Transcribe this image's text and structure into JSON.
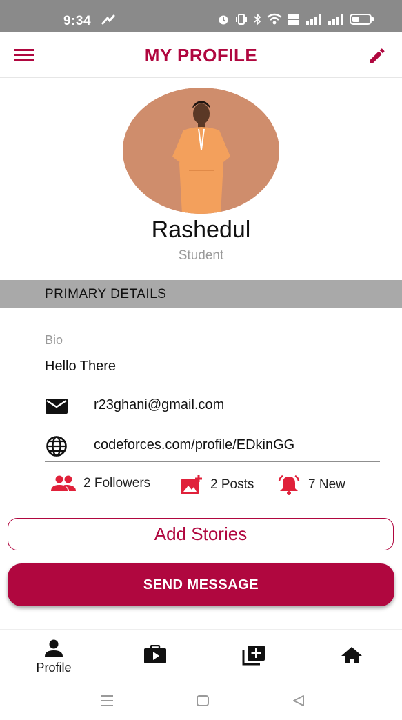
{
  "status_bar": {
    "time": "9:34"
  },
  "app_bar": {
    "title": "MY PROFILE"
  },
  "profile": {
    "name": "Rashedul",
    "role": "Student"
  },
  "section": {
    "primary_details": "PRIMARY DETAILS"
  },
  "details": {
    "bio_label": "Bio",
    "bio_value": "Hello There",
    "email": "r23ghani@gmail.com",
    "website": "codeforces.com/profile/EDkinGG"
  },
  "stats": {
    "followers": "2 Followers",
    "posts": "2 Posts",
    "notifications": "7 New"
  },
  "buttons": {
    "add_stories": "Add Stories",
    "send_message": "SEND MESSAGE"
  },
  "bottom_nav": {
    "profile_label": "Profile"
  },
  "colors": {
    "accent": "#b0073f",
    "stat_icon": "#e0213a",
    "status_bar": "#8a8a8a",
    "section_header": "#a9a9a9"
  },
  "icons": [
    "menu-icon",
    "edit-icon",
    "mail-icon",
    "globe-icon",
    "people-icon",
    "add-photo-icon",
    "alarm-bell-icon",
    "person-icon",
    "video-case-icon",
    "add-library-icon",
    "home-icon"
  ]
}
